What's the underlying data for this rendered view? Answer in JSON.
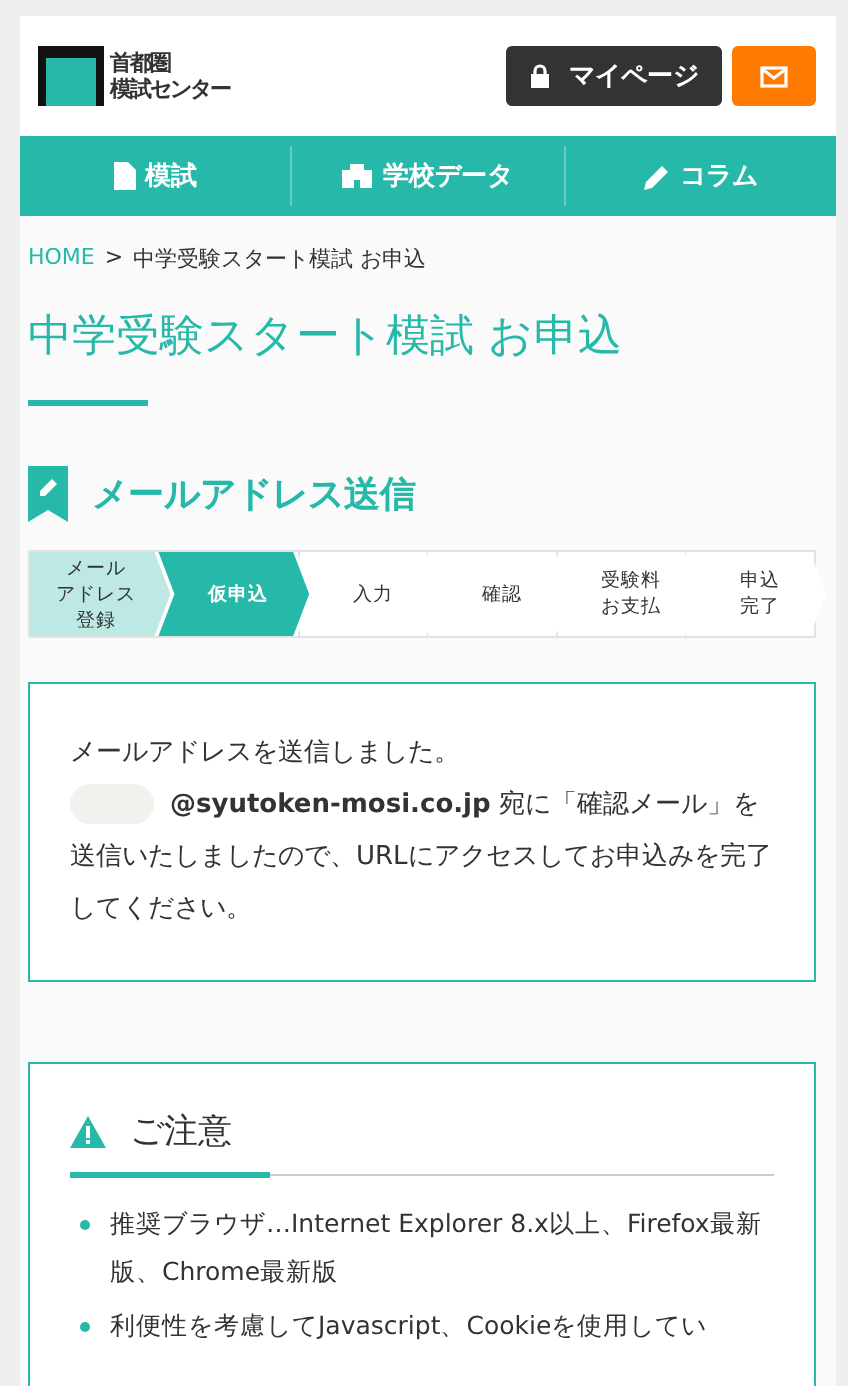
{
  "header": {
    "logo_text": [
      "首都圏",
      "模試センター"
    ],
    "mypage_button": "マイページ"
  },
  "nav": [
    {
      "label": "模試"
    },
    {
      "label": "学校データ"
    },
    {
      "label": "コラム"
    }
  ],
  "breadcrumb": [
    {
      "label": "HOME",
      "kind": "link"
    },
    {
      "label": ">",
      "kind": "separator"
    },
    {
      "label": "中学受験スタート模試 お申込",
      "kind": "current"
    }
  ],
  "page_title": "中学受験スタート模試 お申込",
  "section_title": "メールアドレス送信",
  "steps": [
    {
      "lines": [
        "メール",
        "アドレス",
        "登録"
      ],
      "completed": true,
      "selected": false
    },
    {
      "lines": [
        "仮申込"
      ],
      "completed": false,
      "selected": true
    },
    {
      "lines": [
        "入力"
      ],
      "completed": false,
      "selected": false
    },
    {
      "lines": [
        "確認"
      ],
      "completed": false,
      "selected": false
    },
    {
      "lines": [
        "受験料",
        "お支払"
      ],
      "completed": false,
      "selected": false
    },
    {
      "lines": [
        "申込",
        "完了"
      ],
      "completed": false,
      "selected": false
    }
  ],
  "message": {
    "line1": "メールアドレスを送信しました。",
    "address_redacted": true,
    "text": "**@syutoken-mosi.co.jp** 宛に「確認メール」を送信いたしましたので、URLにアクセスしてお申込みを完了してください。"
  },
  "notice": {
    "title": "ご注意",
    "items": [
      "推奨ブラウザ…Internet Explorer 8.x以上、Firefox最新版、Chrome最新版",
      "利便性を考慮してJavascript、Cookieを使用してい"
    ]
  }
}
